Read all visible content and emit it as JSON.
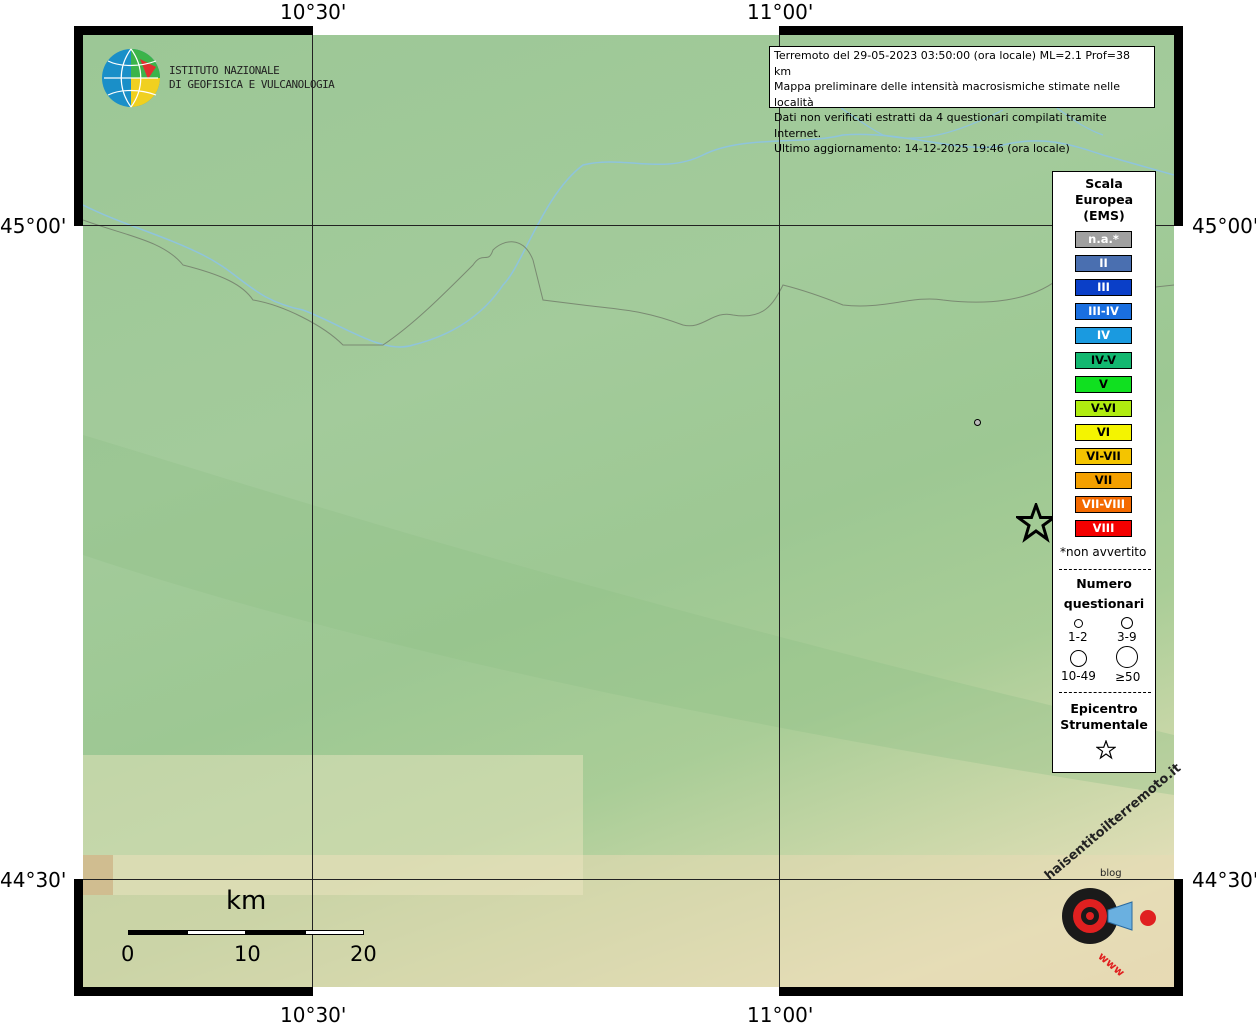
{
  "coords": {
    "lon_left": "10°30'",
    "lon_right": "11°00'",
    "lat_top": "45°00'",
    "lat_bottom": "44°30'"
  },
  "institute": {
    "line1": "ISTITUTO NAZIONALE",
    "line2": "DI GEOFISICA E VULCANOLOGIA"
  },
  "info": {
    "line1": "Terremoto del 29-05-2023 03:50:00 (ora locale) ML=2.1 Prof=38 km",
    "line2": "Mappa preliminare delle intensità macrosismiche stimate nelle località",
    "line3": "Dati non verificati estratti da 4 questionari compilati tramite Internet.",
    "line4": "Ultimo aggiornamento: 14-12-2025 19:46 (ora locale)"
  },
  "legend": {
    "title1": "Scala",
    "title2": "Europea",
    "title3": "(EMS)",
    "ems": [
      {
        "label": "n.a.*",
        "color": "#a0a0a0"
      },
      {
        "label": "II",
        "color": "#4a6fb0"
      },
      {
        "label": "III",
        "color": "#0a3fc8"
      },
      {
        "label": "III-IV",
        "color": "#1a6fe0"
      },
      {
        "label": "IV",
        "color": "#1a9ae0"
      },
      {
        "label": "IV-V",
        "color": "#12b870"
      },
      {
        "label": "V",
        "color": "#10e020"
      },
      {
        "label": "V-VI",
        "color": "#b0ec10"
      },
      {
        "label": "VI",
        "color": "#f4f400"
      },
      {
        "label": "VI-VII",
        "color": "#f4c400"
      },
      {
        "label": "VII",
        "color": "#f4a000"
      },
      {
        "label": "VII-VIII",
        "color": "#f46a00"
      },
      {
        "label": "VIII",
        "color": "#f40000"
      }
    ],
    "not_felt": "*non avvertito",
    "num_title1": "Numero",
    "num_title2": "questionari",
    "size_labels": [
      "1-2",
      "3-9",
      "10-49",
      "≥50"
    ],
    "epi_title1": "Epicentro",
    "epi_title2": "Strumentale"
  },
  "scale": {
    "unit": "km",
    "ticks": [
      "0",
      "10",
      "20"
    ]
  },
  "watermark": {
    "text": "haisentitoilterremoto.it",
    "subtext": "www",
    "blog": "blog"
  }
}
